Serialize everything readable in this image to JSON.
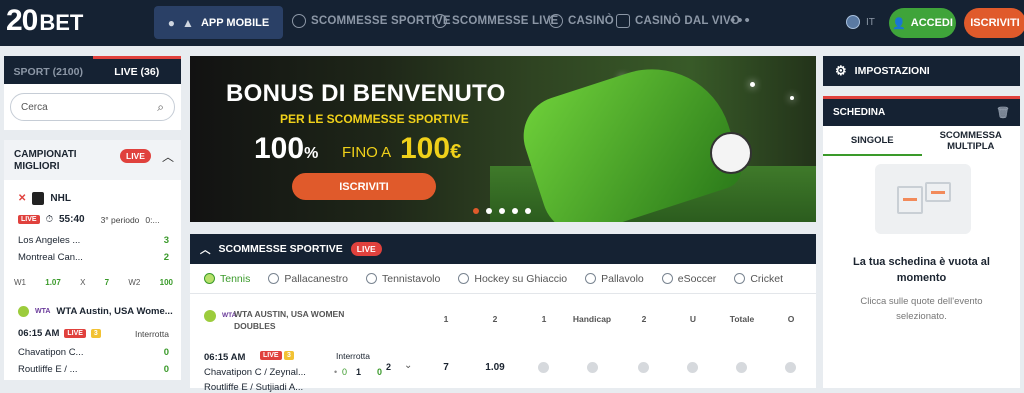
{
  "header": {
    "logo_num": "20",
    "logo_word": "BET",
    "app_button": "APP MOBILE",
    "nav": [
      "SCOMMESSE SPORTIVE",
      "SCOMMESSE LIVE",
      "CASINÒ",
      "CASINÒ DAL VIVO"
    ],
    "more": "•••",
    "lang": "IT",
    "login": "ACCEDI",
    "signup": "ISCRIVITI"
  },
  "left": {
    "tab_sport": "SPORT (2100)",
    "tab_live": "LIVE (36)",
    "search_placeholder": "Cerca",
    "champ_title": "CAMPIONATI MIGLIORI",
    "live": "LIVE",
    "nhl": {
      "league": "NHL",
      "time": "55:40",
      "period": "3° periodo",
      "period_extra": "0:...",
      "team1": "Los Angeles ...",
      "score1": "3",
      "team2": "Montreal Can...",
      "score2": "2",
      "odds": [
        "W1",
        "1.07",
        "X",
        "7",
        "W2",
        "100"
      ]
    },
    "wta": {
      "league": "WTA Austin, USA Wome...",
      "time": "06:15 AM",
      "badge": "3",
      "status": "Interrotta",
      "player1": "Chavatipon C...",
      "score1": "0",
      "player2": "Routliffe E / ...",
      "score2": "0"
    }
  },
  "banner": {
    "title": "BONUS DI BENVENUTO",
    "subtitle": "PER LE SCOMMESSE SPORTIVE",
    "percent": "100",
    "percent_sign": "%",
    "upto": "FINO A",
    "amount": "100",
    "currency": "€",
    "button": "ISCRIVITI"
  },
  "sports": {
    "header": "SCOMMESSE SPORTIVE",
    "live": "LIVE",
    "list": [
      "Tennis",
      "Pallacanestro",
      "Tennistavolo",
      "Hockey su Ghiaccio",
      "Pallavolo",
      "eSoccer",
      "Cricket"
    ],
    "competition": "WTA AUSTIN, USA WOMEN DOUBLES",
    "columns": [
      "1",
      "2",
      "1",
      "Handicap",
      "2",
      "U",
      "Totale",
      "O"
    ],
    "match": {
      "time": "06:15 AM",
      "live": "LIVE",
      "badge": "3",
      "status": "Interrotta",
      "players": "Chavatipon C / Zeynal...",
      "players2": "Routliffe E / Sutjiadi A...",
      "score_a": "0",
      "score_b": "1",
      "score_c": "0",
      "more": "2",
      "odd1": "7",
      "odd2": "1.09"
    }
  },
  "right": {
    "settings": "IMPOSTAZIONI",
    "slip_title": "SCHEDINA",
    "tab_single": "SINGOLE",
    "tab_multi": "SCOMMESSA MULTIPLA",
    "empty_title": "La tua schedina è vuota al momento",
    "empty_text": "Clicca sulle quote dell'evento selezionato."
  }
}
